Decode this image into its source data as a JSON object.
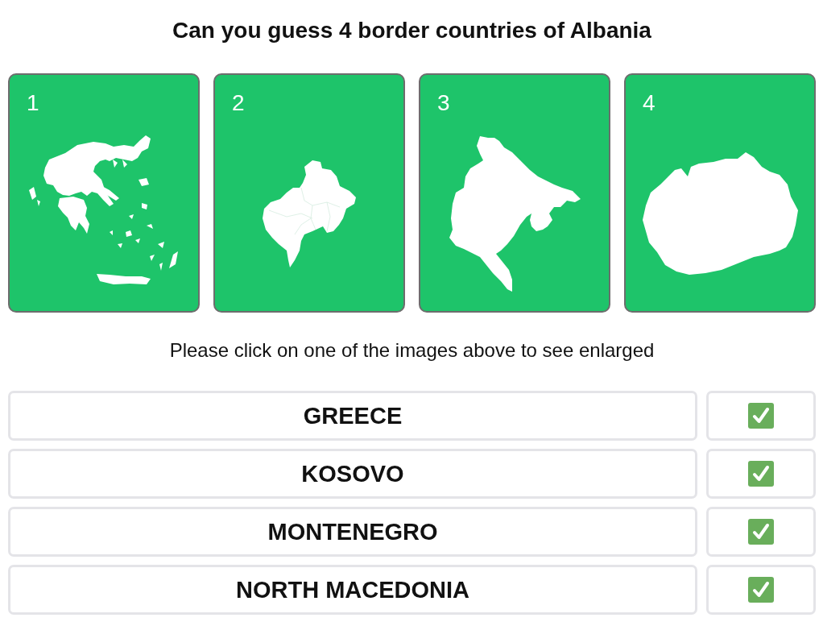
{
  "title": "Can you guess 4 border countries of Albania",
  "cards": [
    {
      "number": "1",
      "kind": "greece"
    },
    {
      "number": "2",
      "kind": "kosovo"
    },
    {
      "number": "3",
      "kind": "montenegro"
    },
    {
      "number": "4",
      "kind": "macedonia"
    }
  ],
  "hint": "Please click on one of the images above to see enlarged",
  "answers": [
    {
      "label": "GREECE",
      "checked": true
    },
    {
      "label": "KOSOVO",
      "checked": true
    },
    {
      "label": "MONTENEGRO",
      "checked": true
    },
    {
      "label": "NORTH MACEDONIA",
      "checked": true
    }
  ]
}
